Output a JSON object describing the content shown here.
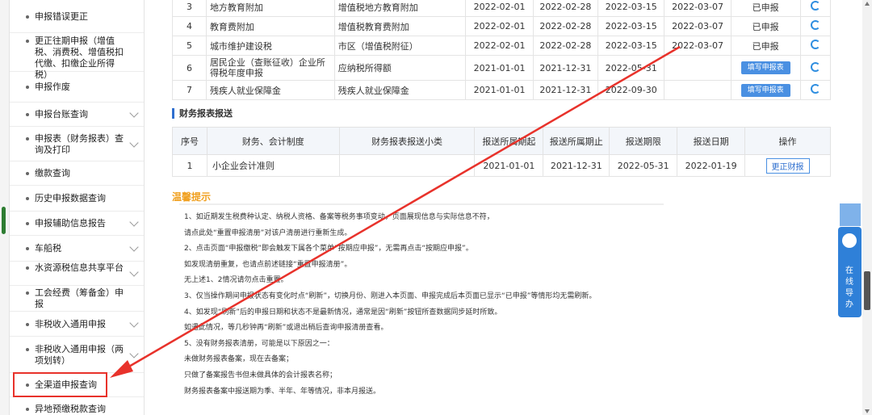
{
  "sidebar": {
    "items": [
      {
        "label": "申报错误更正",
        "chevron": false
      },
      {
        "label": "更正往期申报（增值税、消费税、增值税扣代缴、扣缴企业所得税）",
        "chevron": false
      },
      {
        "label": "申报作废",
        "chevron": false
      },
      {
        "label": "申报台账查询",
        "chevron": true
      },
      {
        "label": "申报表（财务报表）查询及打印",
        "chevron": true
      },
      {
        "label": "缴款查询",
        "chevron": false
      },
      {
        "label": "历史申报数据查询",
        "chevron": false
      },
      {
        "label": "申报辅助信息报告",
        "chevron": true
      },
      {
        "label": "车船税",
        "chevron": true
      },
      {
        "label": "水资源税信息共享平台",
        "chevron": true
      },
      {
        "label": "工会经费（筹备金）申报",
        "chevron": false
      },
      {
        "label": "非税收入通用申报",
        "chevron": true
      },
      {
        "label": "非税收入通用申报（两项划转）",
        "chevron": true
      },
      {
        "label": "全渠道申报查询",
        "chevron": false
      },
      {
        "label": "异地预缴税款查询",
        "chevron": false
      }
    ]
  },
  "tax_table": {
    "rows": [
      {
        "no": "3",
        "name": "地方教育附加",
        "item": "增值税地方教育附加",
        "start": "2022-02-01",
        "end": "2022-02-28",
        "deadline": "2022-03-15",
        "date": "2022-03-07",
        "status": "已申报",
        "action": ""
      },
      {
        "no": "4",
        "name": "教育费附加",
        "item": "增值税教育费附加",
        "start": "2022-02-01",
        "end": "2022-02-28",
        "deadline": "2022-03-15",
        "date": "2022-03-07",
        "status": "已申报",
        "action": ""
      },
      {
        "no": "5",
        "name": "城市维护建设税",
        "item": "市区（增值税附征）",
        "start": "2022-02-01",
        "end": "2022-02-28",
        "deadline": "2022-03-15",
        "date": "2022-03-07",
        "status": "已申报",
        "action": ""
      },
      {
        "no": "6",
        "name": "居民企业（查账征收）企业所得税年度申报",
        "item": "应纳税所得额",
        "start": "2021-01-01",
        "end": "2021-12-31",
        "deadline": "2022-05-31",
        "date": "",
        "status": "",
        "action": "填写申报表"
      },
      {
        "no": "7",
        "name": "残疾人就业保障金",
        "item": "残疾人就业保障金",
        "start": "2021-01-01",
        "end": "2021-12-31",
        "deadline": "2022-09-30",
        "date": "",
        "status": "",
        "action": "填写申报表"
      }
    ]
  },
  "finance": {
    "section_title": "财务报表报送",
    "headers": [
      "序号",
      "财务、会计制度",
      "财务报表报送小类",
      "报送所属期起",
      "报送所属期止",
      "报送期限",
      "报送日期",
      "操作"
    ],
    "rows": [
      {
        "no": "1",
        "system": "小企业会计准则",
        "subtype": "",
        "start": "2021-01-01",
        "end": "2021-12-31",
        "deadline": "2022-05-31",
        "date": "2022-01-19",
        "action": "更正财报"
      }
    ]
  },
  "tips": {
    "title": "温馨提示",
    "lines": [
      "1、如近期发生税费种认定、纳税人资格、备案等税务事项变动，页面展现信息与实际信息不符，",
      "请点此处“重置申报清册”对该户清册进行重新生成。",
      "2、点击页面“申报缴税”即会触发下属各个菜单“按期应申报”，无需再点击“按期应申报”。",
      "如发现清册重复，也请点前述链接“重置申报清册”。",
      "无上述1、2情况请勿点击重置。",
      "3、仅当操作期间申报状态有变化时点“刷新”，切换月份、刚进入本页面、申报完成后本页面已显示“已申报”等情形均无需刷新。",
      "4、如发现“刷新”后的申报日期和状态不是最新情况，通常是因“刷新”按钮所查数据同步延时所致。",
      "如遇此情况，等几秒钟再“刷新”或退出稍后查询申报清册查看。",
      "5、没有财务报表清册，可能是以下原因之一：",
      "未做财务报表备案，现在去备案；",
      "只做了备案报告书但未做具体的会计报表名称；",
      "财务报表备案中报送期为季、半年、年等情况，非本月报送。"
    ]
  },
  "float_panel": {
    "label": "在线导办"
  },
  "colors": {
    "annotation": "#e8322b",
    "accent": "#2f80d8",
    "tips_title": "#f0a020"
  }
}
